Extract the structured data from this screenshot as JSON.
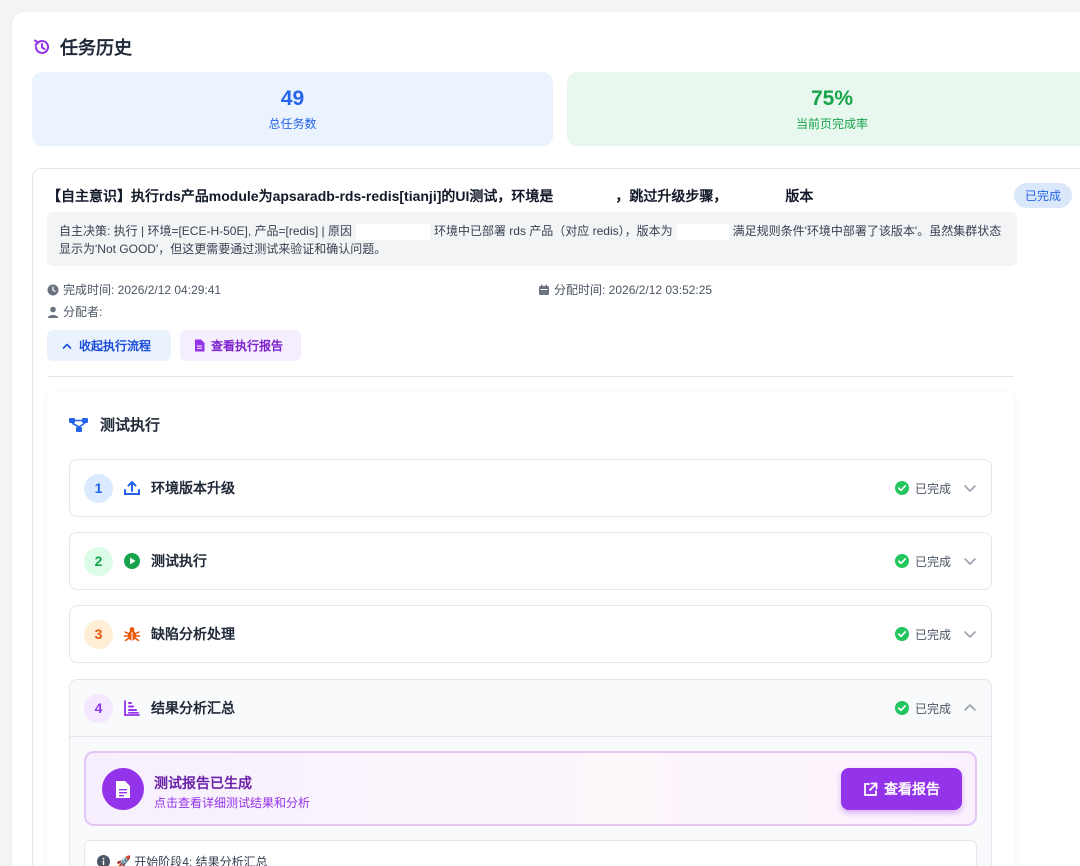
{
  "header": {
    "title": "任务历史"
  },
  "stats": [
    {
      "value": "49",
      "label": "总任务数"
    },
    {
      "value": "75%",
      "label": "当前页完成率"
    }
  ],
  "task": {
    "title_part1": "【自主意识】执行rds产品module为apsaradb-rds-redis[tianji]的UI测试，环境是",
    "title_part2": "，跳过升级步骤，",
    "title_part3": "版本",
    "status": "已完成",
    "reason_part1": "自主决策: 执行 | 环境=[ECE-H-50E], 产品=[redis] | 原因",
    "reason_part2": "环境中已部署 rds 产品（对应 redis），版本为",
    "reason_part3": "满足规则条件'环境中部署了该版本'。虽然集群状态显示为'Not GOOD'，但这更需要通过测试来验证和确认问题。",
    "completed_time": "完成时间: 2026/2/12 04:29:41",
    "assigned_time": "分配时间: 2026/2/12 03:52:25",
    "assignee": "分配者:",
    "collapse_label": "收起执行流程",
    "report_label": "查看执行报告"
  },
  "execution": {
    "title": "测试执行",
    "stages": [
      {
        "num": "1",
        "name": "环境版本升级",
        "status": "已完成"
      },
      {
        "num": "2",
        "name": "测试执行",
        "status": "已完成"
      },
      {
        "num": "3",
        "name": "缺陷分析处理",
        "status": "已完成"
      },
      {
        "num": "4",
        "name": "结果分析汇总",
        "status": "已完成"
      }
    ],
    "report": {
      "title": "测试报告已生成",
      "subtitle": "点击查看详细测试结果和分析",
      "button": "查看报告"
    },
    "log": "🚀 开始阶段4: 结果分析汇总"
  },
  "colors": {
    "blue": "#2563eb",
    "green": "#16a34a",
    "orange": "#ea580c",
    "purple": "#9333ea"
  }
}
